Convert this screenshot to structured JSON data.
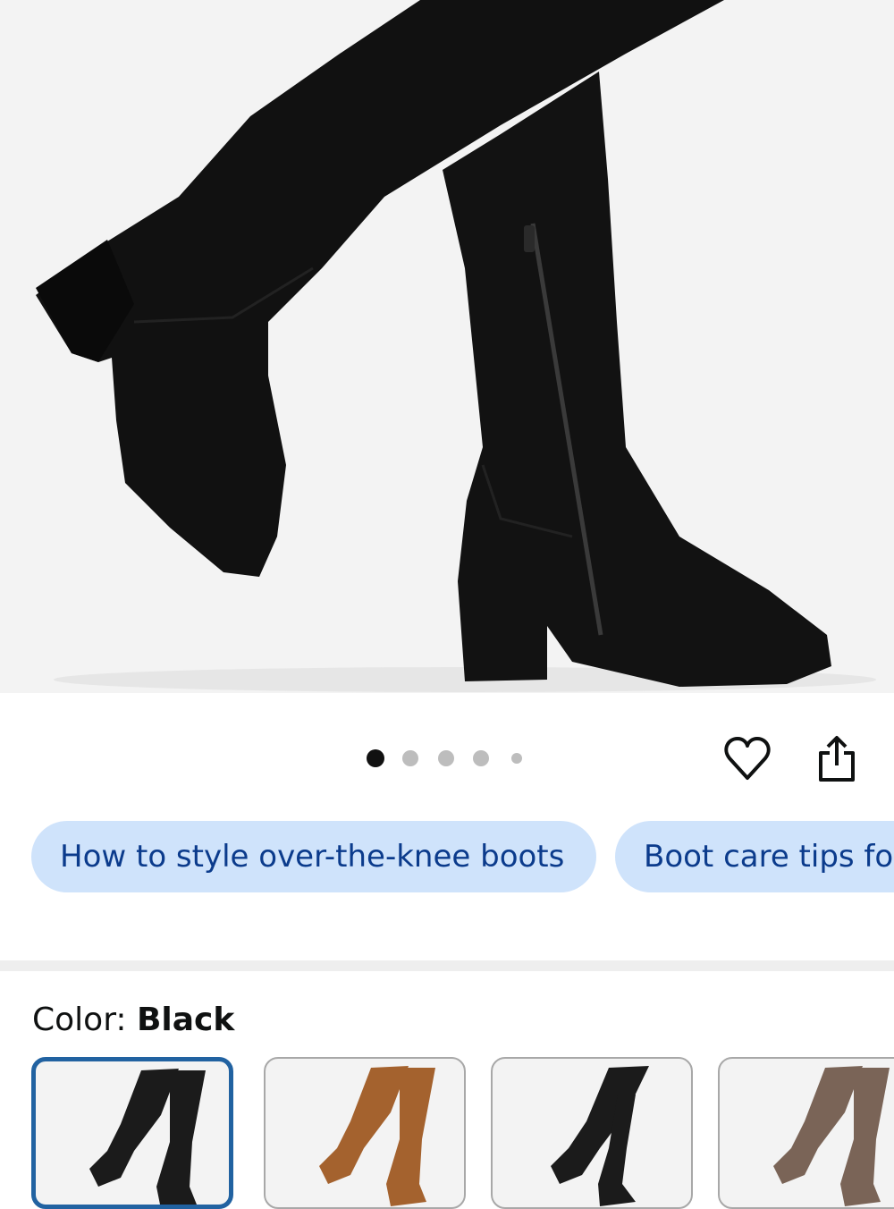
{
  "product_image": {
    "alt": "Black over-the-knee block-heel boots",
    "dots_count": 5,
    "active_dot": 0
  },
  "actions": {
    "wishlist_icon": "heart-icon",
    "share_icon": "share-icon"
  },
  "chips": [
    {
      "label": "How to style over-the-knee boots"
    },
    {
      "label": "Boot care tips for"
    }
  ],
  "color": {
    "label": "Color: ",
    "value": "Black",
    "swatches": [
      {
        "name": "Black",
        "hex": "#1b1b1b",
        "selected": true
      },
      {
        "name": "Brown",
        "hex": "#a4622e",
        "selected": false
      },
      {
        "name": "Black",
        "hex": "#1b1b1b",
        "selected": false
      },
      {
        "name": "Taupe",
        "hex": "#7a6457",
        "selected": false
      }
    ]
  },
  "colors": {
    "chip_bg": "#cfe3fb",
    "chip_text": "#0b3b8c",
    "selected_border": "#2162a1"
  }
}
